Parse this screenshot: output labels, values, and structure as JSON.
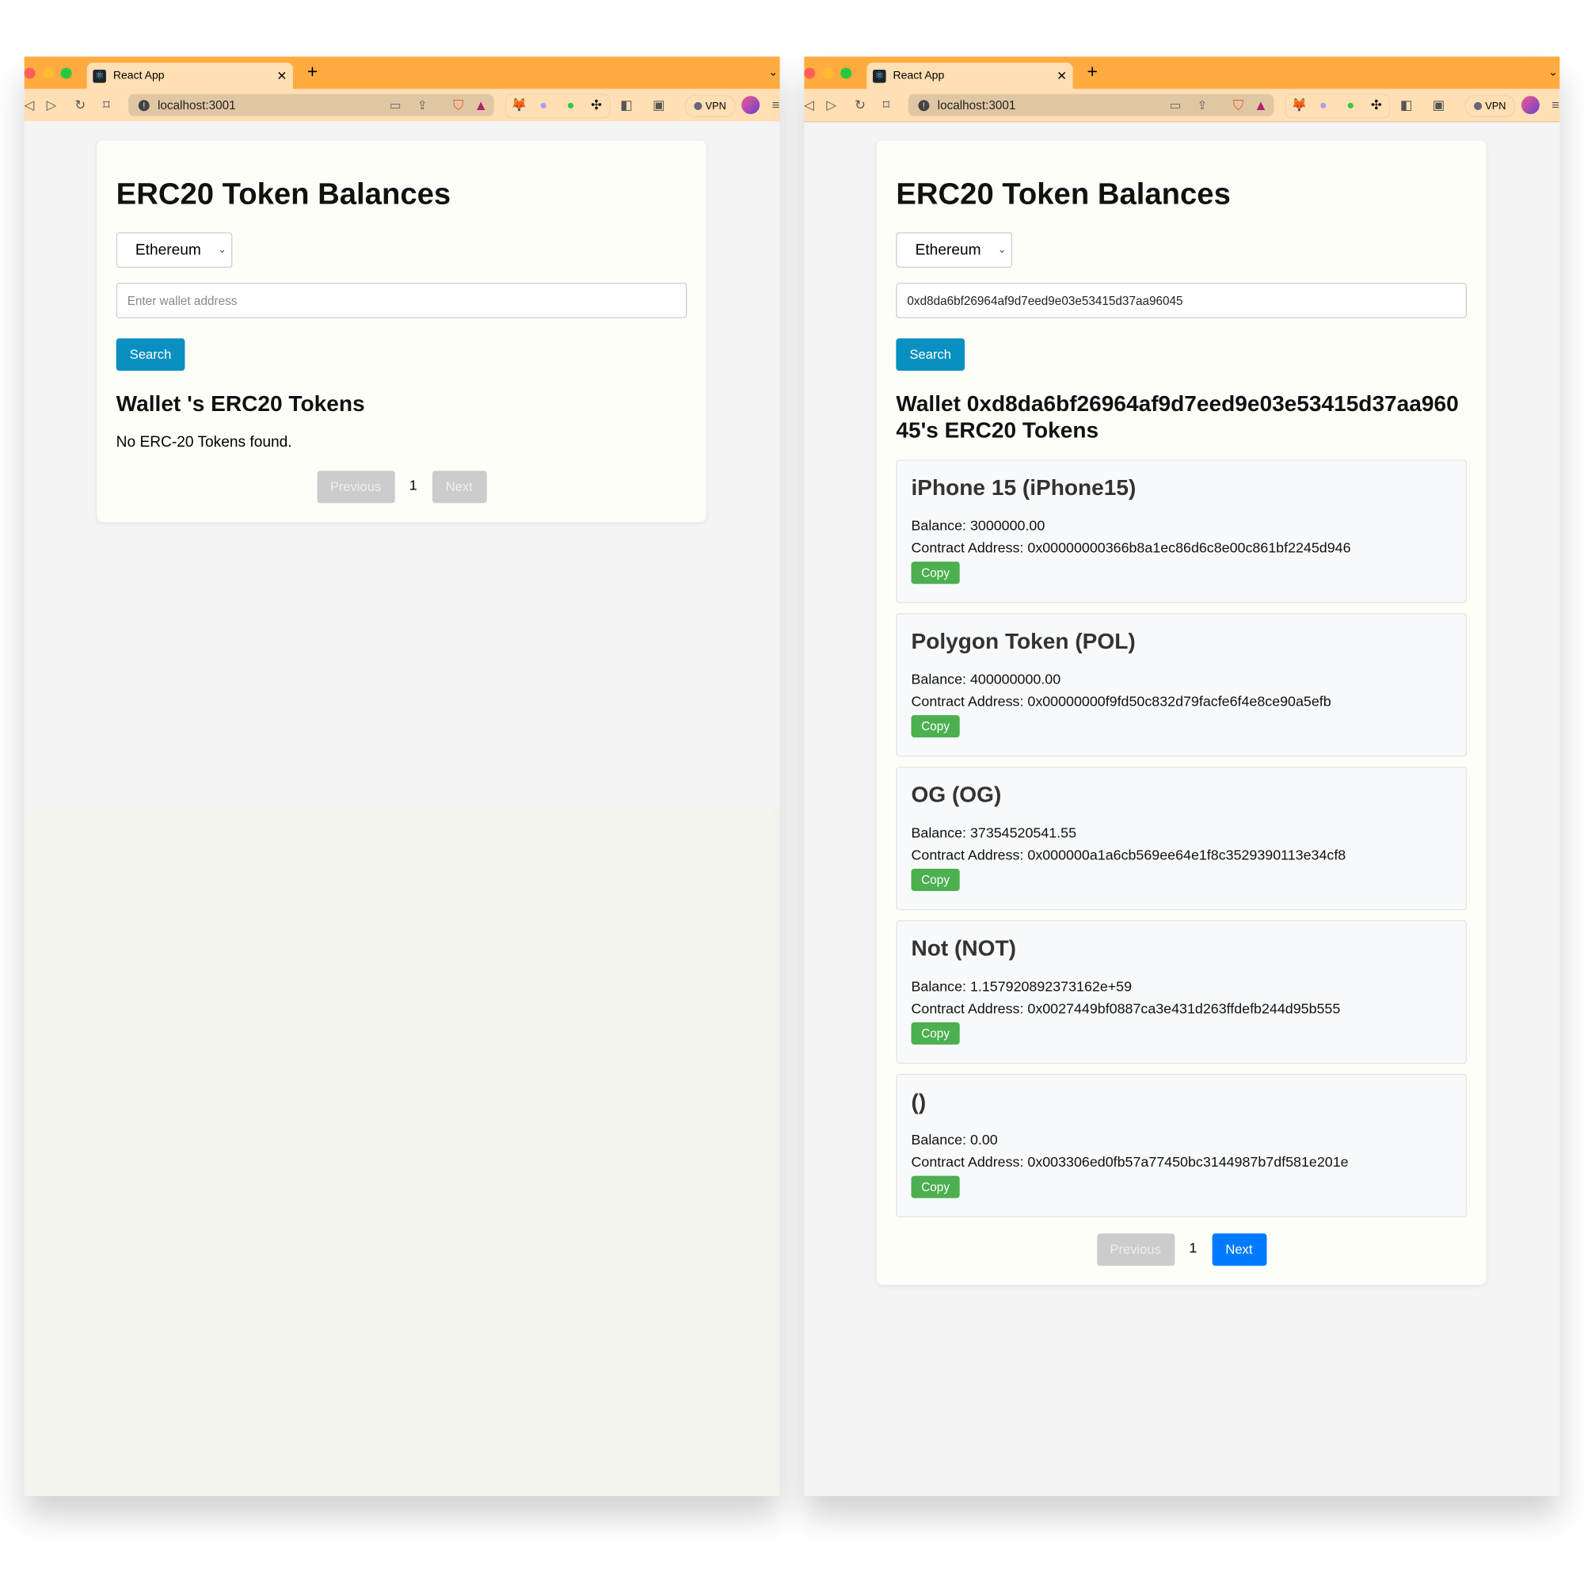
{
  "browser": {
    "tab_title": "React App",
    "url": "localhost:3001",
    "vpn_label": "VPN",
    "colors": {
      "tabbar": "#ffab40",
      "toolbar": "#ffdfb3"
    }
  },
  "left": {
    "title": "ERC20 Token Balances",
    "network": "Ethereum",
    "address_placeholder": "Enter wallet address",
    "address_value": "",
    "search_label": "Search",
    "heading": "Wallet 's ERC20 Tokens",
    "empty_message": "No ERC-20 Tokens found.",
    "pagination": {
      "previous": "Previous",
      "page": "1",
      "next": "Next"
    }
  },
  "right": {
    "title": "ERC20 Token Balances",
    "network": "Ethereum",
    "address_value": "0xd8da6bf26964af9d7eed9e03e53415d37aa96045",
    "search_label": "Search",
    "heading": "Wallet 0xd8da6bf26964af9d7eed9e03e53415d37aa96045's ERC20 Tokens",
    "tokens": [
      {
        "name": "iPhone 15 (iPhone15)",
        "balance": "Balance: 3000000.00",
        "contract": "Contract Address: 0x00000000366b8a1ec86d6c8e00c861bf2245d946",
        "copy": "Copy"
      },
      {
        "name": "Polygon Token (POL)",
        "balance": "Balance: 400000000.00",
        "contract": "Contract Address: 0x00000000f9fd50c832d79facfe6f4e8ce90a5efb",
        "copy": "Copy"
      },
      {
        "name": "OG (OG)",
        "balance": "Balance: 37354520541.55",
        "contract": "Contract Address: 0x000000a1a6cb569ee64e1f8c3529390113e34cf8",
        "copy": "Copy"
      },
      {
        "name": "Not (NOT)",
        "balance": "Balance: 1.157920892373162e+59",
        "contract": "Contract Address: 0x0027449bf0887ca3e431d263ffdefb244d95b555",
        "copy": "Copy"
      },
      {
        "name": "()",
        "balance": "Balance: 0.00",
        "contract": "Contract Address: 0x003306ed0fb57a77450bc3144987b7df581e201e",
        "copy": "Copy"
      }
    ],
    "pagination": {
      "previous": "Previous",
      "page": "1",
      "next": "Next"
    }
  }
}
